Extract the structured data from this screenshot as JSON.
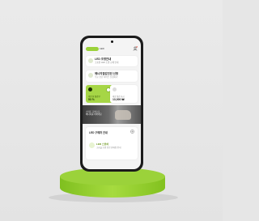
{
  "app": {
    "logo_text": "LED",
    "accent_color": "#9bd23a",
    "profile_icon": "profile-icon"
  },
  "cards": [
    {
      "title": "LED 조명안내",
      "subtitle": "고효율 LED 조명 교체 안내",
      "icon": "bulb-icon"
    },
    {
      "title": "에너지절감진단 신청",
      "subtitle": "무료 진단 서비스 신청하기",
      "icon": "energy-icon"
    }
  ],
  "tiles": {
    "green": {
      "label": "이번 달 절감량",
      "value": "53 %",
      "icon": "leaf-icon",
      "check_icon": "check-icon"
    },
    "white": {
      "label": "예상 절감 요금",
      "value": "13,000 ₩",
      "icon": "coin-icon"
    }
  },
  "banner": {
    "line1": "스마트 조명으로",
    "line2": "에너지를 아끼세요"
  },
  "section": {
    "title": "LED 구매처 안내",
    "more_icon": "more-icon",
    "item": {
      "name": "LED 스토어",
      "desc": "고효율 조명 전문 판매점 안내"
    }
  }
}
